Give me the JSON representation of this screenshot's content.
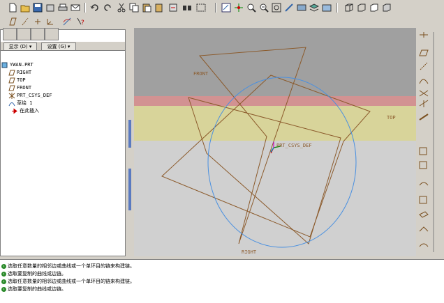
{
  "toolbar_icons": [
    "new-icon",
    "open-icon",
    "save-icon",
    "save-copy-icon",
    "print-icon",
    "email-icon",
    "undo-icon",
    "redo-icon",
    "cut-icon",
    "copy-icon",
    "paste-icon",
    "paste-special-icon",
    "regenerate-icon",
    "find-icon",
    "select-box-icon",
    "repaint-icon",
    "spin-center-icon",
    "zoom-in-icon",
    "zoom-out-icon",
    "refit-icon",
    "reorient-icon",
    "saved-views-icon",
    "layers-icon",
    "wireframe-icon",
    "hidden-line-icon",
    "no-hidden-icon",
    "shading-icon"
  ],
  "menu": {
    "show": "显示 (D) ▾",
    "settings": "设置 (G) ▾"
  },
  "tree": {
    "root": "YWAN.PRT",
    "items": [
      {
        "label": "RIGHT",
        "icon": "datum-plane-icon"
      },
      {
        "label": "TOP",
        "icon": "datum-plane-icon"
      },
      {
        "label": "FRONT",
        "icon": "datum-plane-icon"
      },
      {
        "label": "PRT_CSYS_DEF",
        "icon": "csys-icon"
      },
      {
        "label": "草绘 1",
        "icon": "sketch-icon"
      },
      {
        "label": "在此插入",
        "icon": "insert-here-icon"
      }
    ]
  },
  "canvas": {
    "labels": {
      "front": "FRONT",
      "top": "TOP",
      "right": "RIGHT",
      "csys": "PRT_CSYS_DEF"
    },
    "colors": {
      "band_dark": "#a0a0a0",
      "band_red": "#d29292",
      "band_yellow": "#d8d49a",
      "plane": "#8b5a2b",
      "circle": "#4a90e0"
    }
  },
  "messages": [
    "选取任意数量的相邻边或曲线或一个单环目的链来构建链。",
    "选取要复制的曲线或边链。",
    "选取任意数量的相邻边或曲线或一个单环目的链来构建链。",
    "选取要复制的曲线或边链。"
  ]
}
